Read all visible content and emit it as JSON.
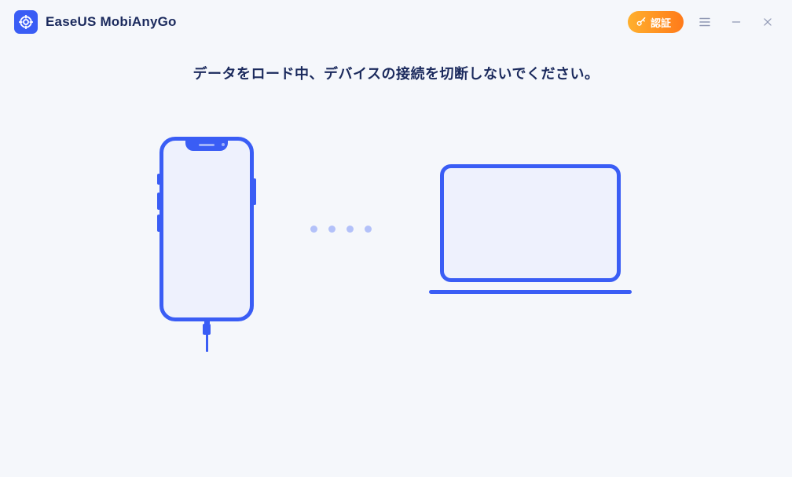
{
  "app": {
    "title": "EaseUS MobiAnyGo"
  },
  "titlebar": {
    "verify_label": "認証"
  },
  "status": {
    "message": "データをロード中、デバイスの接続を切断しないでください。"
  }
}
